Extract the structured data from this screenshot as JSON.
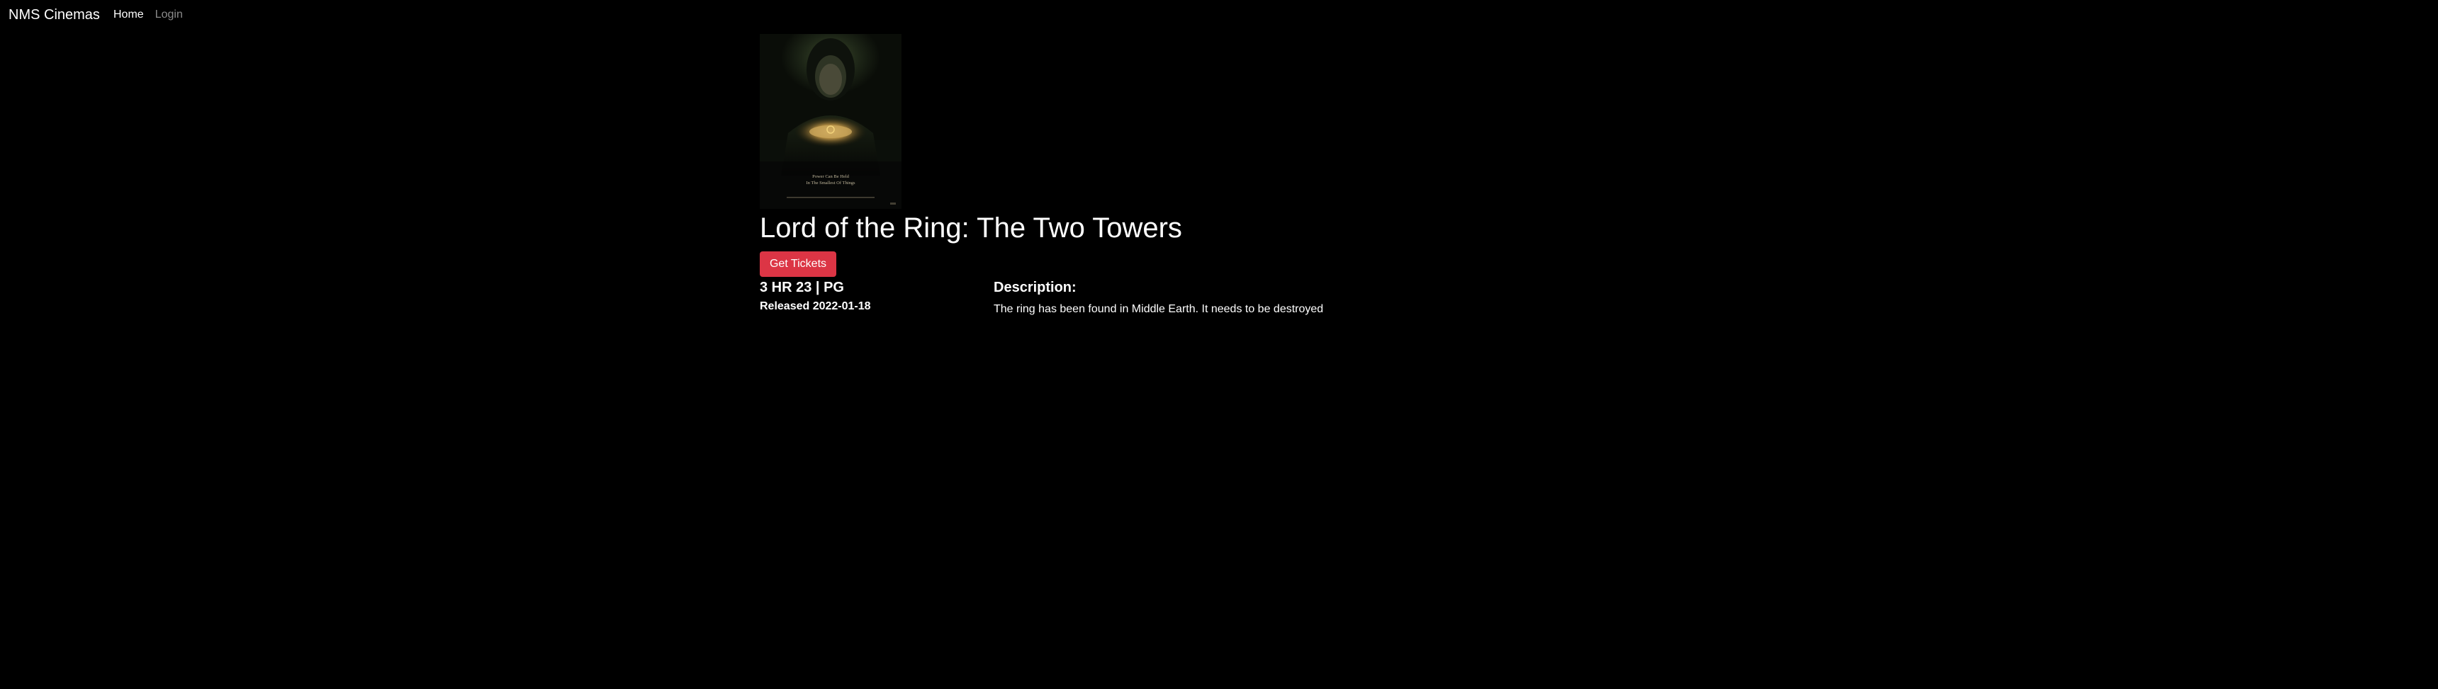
{
  "navbar": {
    "brand": "NMS Cinemas",
    "links": [
      {
        "label": "Home"
      },
      {
        "label": "Login"
      }
    ]
  },
  "movie": {
    "title": "Lord of the Ring: The Two Towers",
    "get_tickets_label": "Get Tickets",
    "runtime_rating": "3 HR 23 | PG",
    "released": "Released 2022-01-18",
    "description_heading": "Description:",
    "description": "The ring has been found in Middle Earth. It needs to be destroyed",
    "poster": {
      "tagline_line1": "Power Can Be Held",
      "tagline_line2": "In The Smallest Of Things"
    }
  },
  "colors": {
    "background": "#000000",
    "text": "#ffffff",
    "muted_link": "#8c8c8c",
    "button": "#dc3545"
  }
}
